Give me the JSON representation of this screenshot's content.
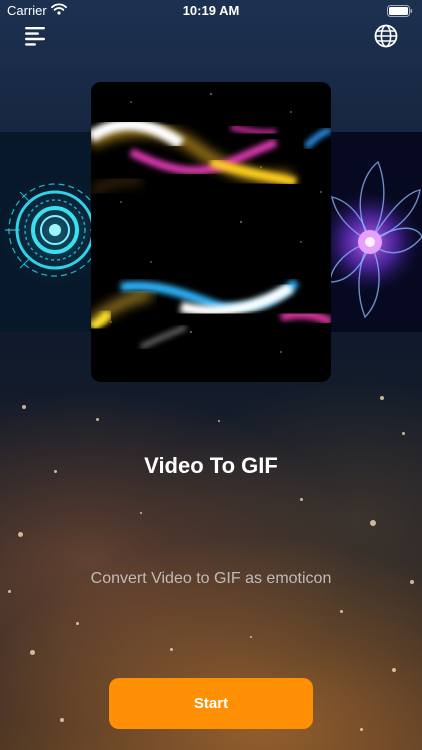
{
  "status_bar": {
    "carrier": "Carrier",
    "time": "10:19 AM",
    "wifi_icon": "wifi-icon",
    "battery_icon": "battery-icon"
  },
  "top_bar": {
    "menu_icon": "menu-icon",
    "language_icon": "globe-icon"
  },
  "carousel": {
    "items": [
      {
        "name": "hud-circle-thumbnail"
      },
      {
        "name": "particle-streaks-preview"
      },
      {
        "name": "purple-flower-thumbnail"
      }
    ]
  },
  "main": {
    "title": "Video To GIF",
    "subtitle": "Convert Video to GIF as emoticon"
  },
  "actions": {
    "start_label": "Start"
  },
  "colors": {
    "accent": "#ff9006",
    "text_primary": "#ffffff",
    "text_secondary": "#c8cad2"
  }
}
